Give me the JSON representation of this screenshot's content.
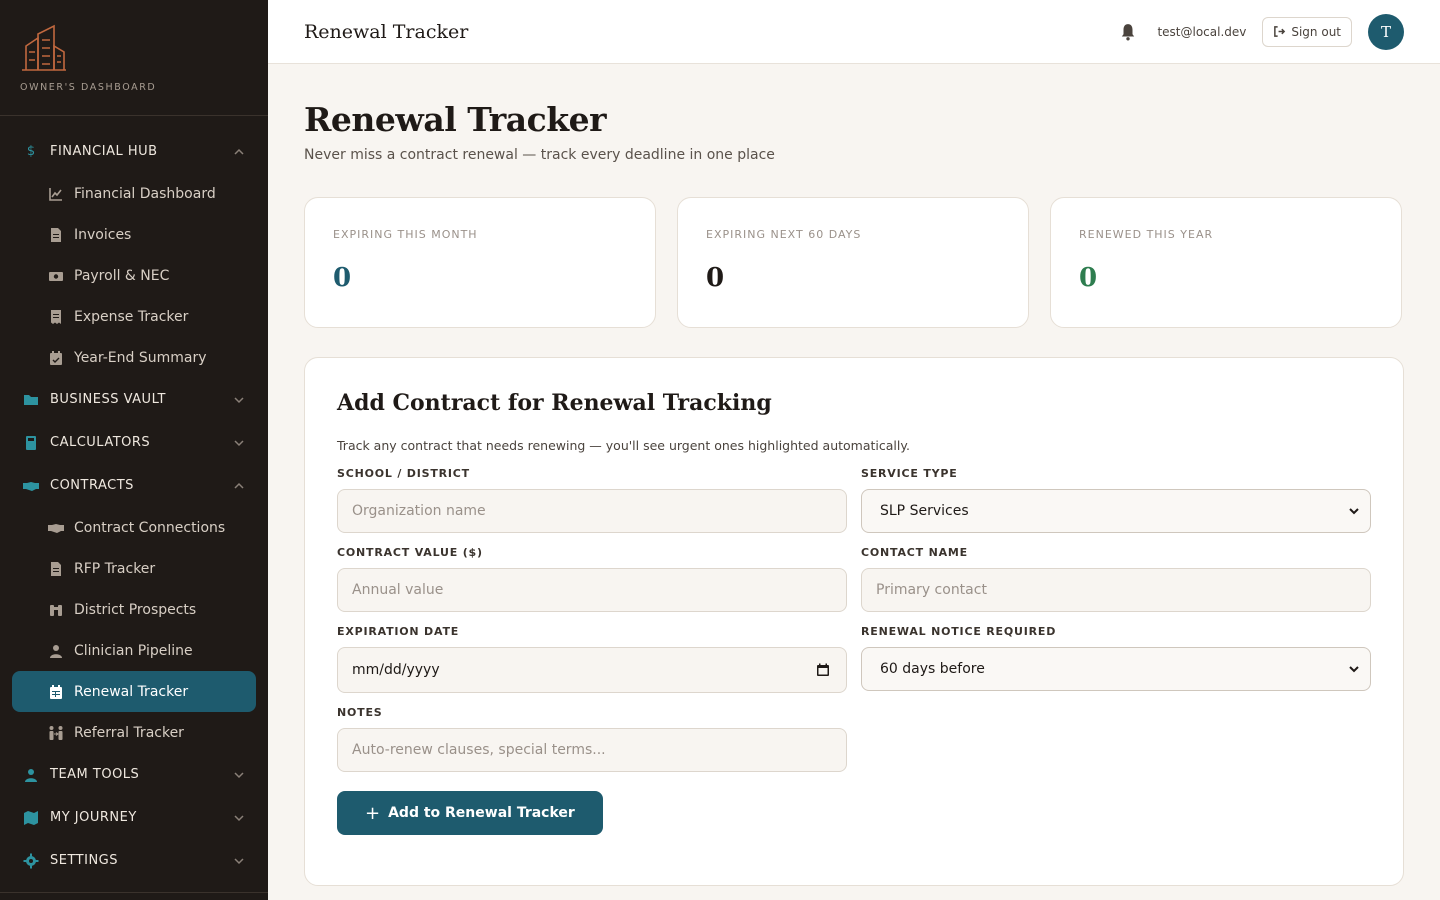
{
  "sidebar": {
    "brand": "OWNER'S DASHBOARD",
    "sections": [
      {
        "label": "FINANCIAL HUB",
        "icon": "dollar-icon",
        "expanded": true,
        "items": [
          {
            "label": "Financial Dashboard",
            "icon": "chart-line-icon"
          },
          {
            "label": "Invoices",
            "icon": "file-icon"
          },
          {
            "label": "Payroll & NEC",
            "icon": "money-icon"
          },
          {
            "label": "Expense Tracker",
            "icon": "receipt-icon"
          },
          {
            "label": "Year-End Summary",
            "icon": "calendar-check-icon"
          }
        ]
      },
      {
        "label": "BUSINESS VAULT",
        "icon": "folder-icon",
        "expanded": false
      },
      {
        "label": "CALCULATORS",
        "icon": "calculator-icon",
        "expanded": false
      },
      {
        "label": "CONTRACTS",
        "icon": "handshake-icon",
        "expanded": true,
        "items": [
          {
            "label": "Contract Connections",
            "icon": "handshake-icon"
          },
          {
            "label": "RFP Tracker",
            "icon": "file-icon"
          },
          {
            "label": "District Prospects",
            "icon": "binoculars-icon"
          },
          {
            "label": "Clinician Pipeline",
            "icon": "user-icon"
          },
          {
            "label": "Renewal Tracker",
            "icon": "calendar-icon",
            "active": true
          },
          {
            "label": "Referral Tracker",
            "icon": "people-arrows-icon"
          }
        ]
      },
      {
        "label": "TEAM TOOLS",
        "icon": "user-icon",
        "expanded": false
      },
      {
        "label": "MY JOURNEY",
        "icon": "map-icon",
        "expanded": false
      },
      {
        "label": "SETTINGS",
        "icon": "gear-icon",
        "expanded": false
      }
    ]
  },
  "header": {
    "title": "Renewal Tracker",
    "email": "test@local.dev",
    "signout": "Sign out",
    "avatar_initial": "T"
  },
  "page": {
    "title": "Renewal Tracker",
    "subtitle": "Never miss a contract renewal — track every deadline in one place"
  },
  "stats": [
    {
      "label": "EXPIRING THIS MONTH",
      "value": "0",
      "color": "#1e5b6e"
    },
    {
      "label": "EXPIRING NEXT 60 DAYS",
      "value": "0",
      "color": "#1f1a17"
    },
    {
      "label": "RENEWED THIS YEAR",
      "value": "0",
      "color": "#2e7d4f"
    }
  ],
  "form": {
    "title": "Add Contract for Renewal Tracking",
    "description": "Track any contract that needs renewing — you'll see urgent ones highlighted automatically.",
    "school_label": "SCHOOL / DISTRICT",
    "school_placeholder": "Organization name",
    "service_label": "SERVICE TYPE",
    "service_value": "SLP Services",
    "value_label": "CONTRACT VALUE ($)",
    "value_placeholder": "Annual value",
    "contact_label": "CONTACT NAME",
    "contact_placeholder": "Primary contact",
    "expiration_label": "EXPIRATION DATE",
    "expiration_placeholder": "mm/dd/yyyy",
    "notice_label": "RENEWAL NOTICE REQUIRED",
    "notice_value": "60 days before",
    "notes_label": "NOTES",
    "notes_placeholder": "Auto-renew clauses, special terms...",
    "submit_label": "Add to Renewal Tracker"
  },
  "colors": {
    "accent": "#1e5b6e",
    "sidebar_bg": "#1f1a17",
    "page_bg": "#f8f5f1",
    "success": "#2e7d4f"
  }
}
